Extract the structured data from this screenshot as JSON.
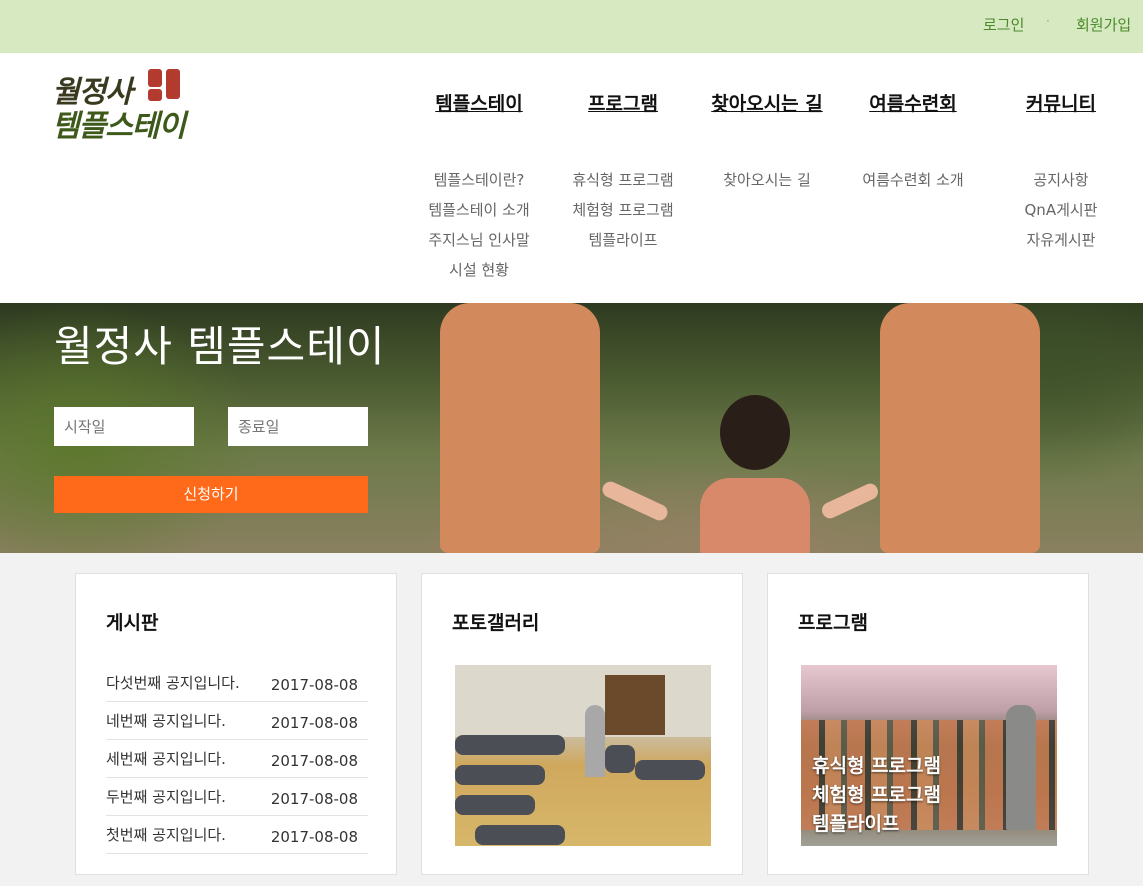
{
  "topbar": {
    "login": "로그인",
    "separator": "·",
    "join": "회원가입"
  },
  "logo": {
    "line1": "월정사",
    "line2": "템플스테이"
  },
  "nav": [
    {
      "label": "템플스테이",
      "sub": [
        "템플스테이란?",
        "템플스테이 소개",
        "주지스님 인사말",
        "시설 현황"
      ]
    },
    {
      "label": "프로그램",
      "sub": [
        "휴식형 프로그램",
        "체험형 프로그램",
        "템플라이프"
      ]
    },
    {
      "label": "찾아오시는 길",
      "sub": [
        "찾아오시는 길"
      ]
    },
    {
      "label": "여름수련회",
      "sub": [
        "여름수련회 소개"
      ]
    },
    {
      "label": "커뮤니티",
      "sub": [
        "공지사항",
        "QnA게시판",
        "자유게시판"
      ]
    }
  ],
  "hero": {
    "title": "월정사 템플스테이",
    "start_placeholder": "시작일",
    "end_placeholder": "종료일",
    "apply_label": "신청하기"
  },
  "board": {
    "title": "게시판",
    "posts": [
      {
        "title": "다섯번째 공지입니다.",
        "date": "2017-08-08"
      },
      {
        "title": "네번째 공지입니다.",
        "date": "2017-08-08"
      },
      {
        "title": "세번째 공지입니다.",
        "date": "2017-08-08"
      },
      {
        "title": "두번째 공지입니다.",
        "date": "2017-08-08"
      },
      {
        "title": "첫번째 공지입니다.",
        "date": "2017-08-08"
      }
    ]
  },
  "gallery": {
    "title": "포토갤러리"
  },
  "program": {
    "title": "프로그램",
    "links": [
      "휴식형 프로그램",
      "체험형 프로그램",
      "템플라이프"
    ]
  },
  "colors": {
    "topbar": "#d6e9c0",
    "accent": "#ff6a1a",
    "link": "#4b8a2a"
  }
}
